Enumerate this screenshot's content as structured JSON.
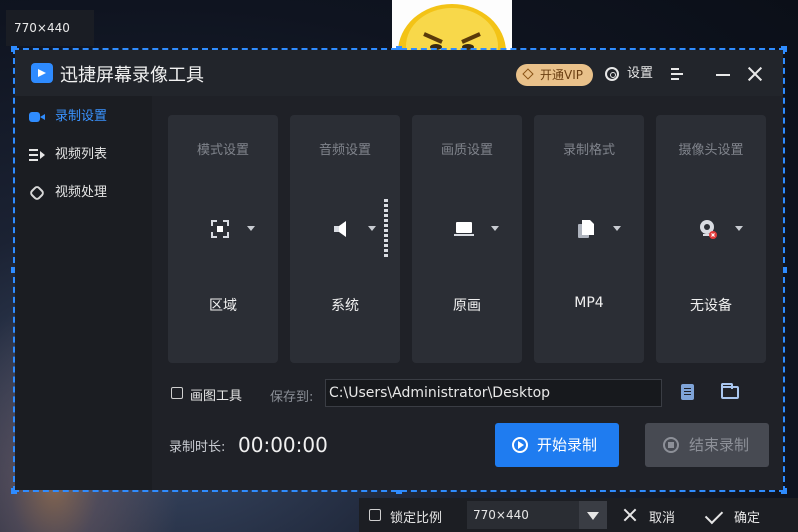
{
  "screen": {
    "dimension_label_top": "770×440"
  },
  "app": {
    "title": "迅捷屏幕录像工具",
    "vip_label": "开通VIP",
    "settings_label": "设置",
    "accent": "#1f7cf0"
  },
  "sidebar": {
    "items": [
      {
        "label": "录制设置",
        "icon": "video-camera-icon",
        "active": true
      },
      {
        "label": "视频列表",
        "icon": "list-play-icon",
        "active": false
      },
      {
        "label": "视频处理",
        "icon": "scissors-icon",
        "active": false
      }
    ]
  },
  "cards": [
    {
      "title": "模式设置",
      "value": "区域",
      "icon": "region-select-icon"
    },
    {
      "title": "音频设置",
      "value": "系统",
      "icon": "speaker-icon"
    },
    {
      "title": "画质设置",
      "value": "原画",
      "icon": "monitor-icon"
    },
    {
      "title": "录制格式",
      "value": "MP4",
      "icon": "file-format-icon"
    },
    {
      "title": "摄像头设置",
      "value": "无设备",
      "icon": "webcam-disabled-icon"
    }
  ],
  "drawing_tool": {
    "label": "画图工具",
    "checked": false
  },
  "save_path": {
    "label": "保存到:",
    "value": "C:\\Users\\Administrator\\Desktop"
  },
  "recording": {
    "duration_label": "录制时长:",
    "duration": "00:00:00",
    "start_label": "开始录制",
    "stop_label": "结束录制"
  },
  "bottom_bar": {
    "lock_ratio_label": "锁定比例",
    "lock_ratio_checked": false,
    "dimension_value": "770×440",
    "cancel_label": "取消",
    "confirm_label": "确定"
  }
}
